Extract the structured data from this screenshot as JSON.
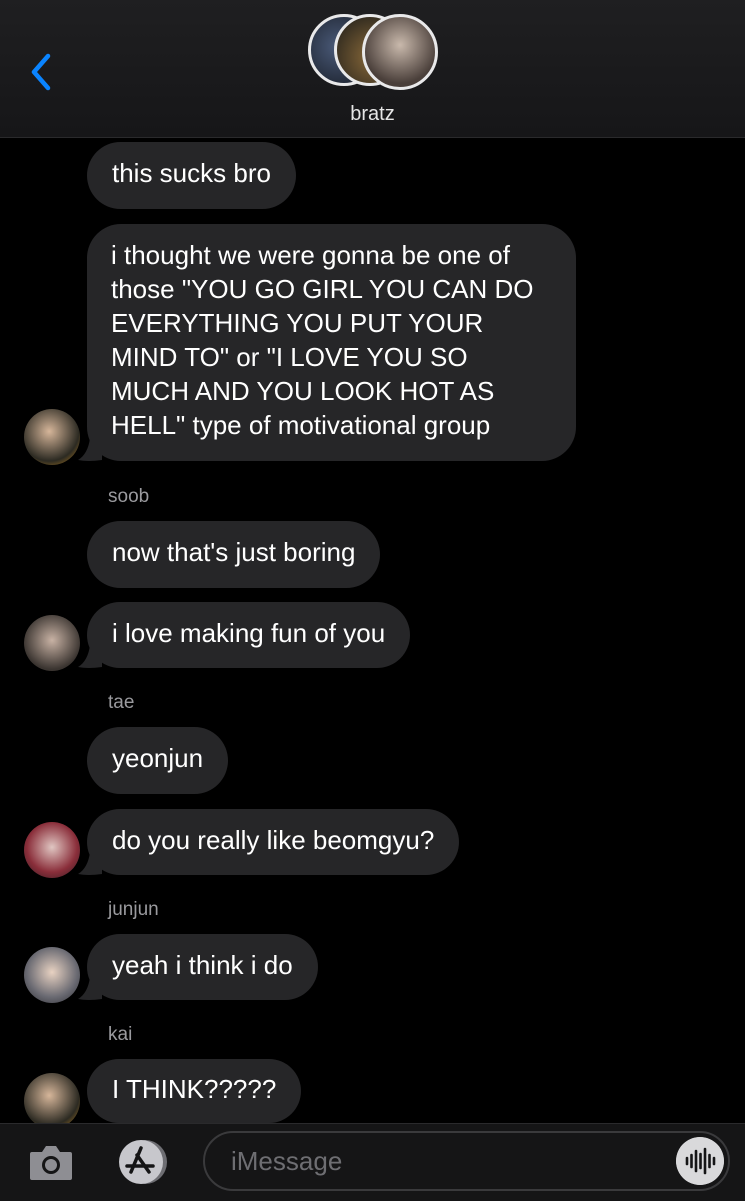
{
  "header": {
    "group_name": "bratz"
  },
  "messages": [
    {
      "text": "this sucks bro"
    },
    {
      "text": "i thought we were gonna be one of those \"YOU GO GIRL YOU CAN DO EVERYTHING YOU PUT YOUR MIND TO\" or \"I LOVE YOU SO MUCH AND YOU LOOK HOT AS HELL\" type of motivational group"
    },
    {
      "sender": "soob",
      "text": "now that's just boring"
    },
    {
      "text": "i love making fun of you"
    },
    {
      "sender": "tae",
      "text": "yeonjun"
    },
    {
      "text": "do you really like beomgyu?"
    },
    {
      "sender": "junjun",
      "text": "yeah i think i do"
    },
    {
      "sender": "kai",
      "text": "I THINK?????"
    }
  ],
  "input": {
    "placeholder": "iMessage"
  },
  "icons": {
    "back": "chevron-left-icon",
    "camera": "camera-icon",
    "apps": "app-store-icon",
    "audio": "audio-waveform-icon"
  },
  "colors": {
    "accent": "#0a84ff",
    "bubble": "#262628",
    "background": "#000000"
  }
}
